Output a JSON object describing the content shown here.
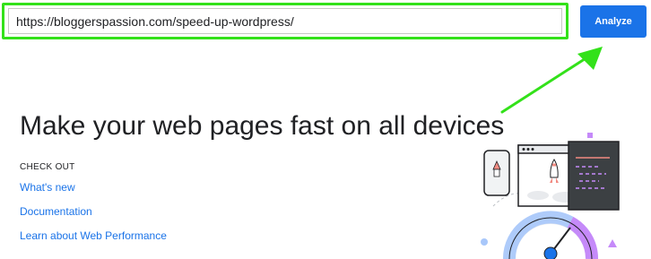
{
  "url_bar": {
    "value": "https://bloggerspassion.com/speed-up-wordpress/"
  },
  "analyze_button": {
    "label": "Analyze"
  },
  "headline": "Make your web pages fast on all devices",
  "check_out": {
    "heading": "CHECK OUT",
    "links": [
      "What's new",
      "Documentation",
      "Learn about Web Performance"
    ]
  },
  "colors": {
    "highlight_green": "#33e11a",
    "brand_blue": "#1a73e8",
    "text_dark": "#202124"
  }
}
